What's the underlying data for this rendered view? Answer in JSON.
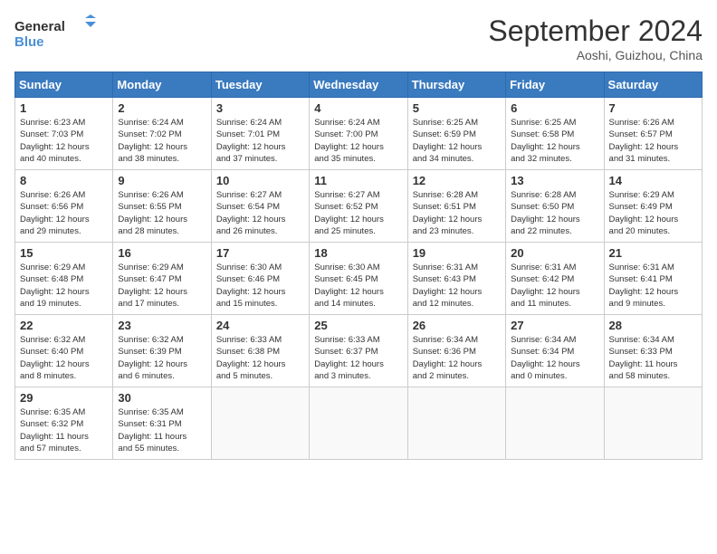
{
  "logo": {
    "line1": "General",
    "line2": "Blue"
  },
  "title": "September 2024",
  "location": "Aoshi, Guizhou, China",
  "days_of_week": [
    "Sunday",
    "Monday",
    "Tuesday",
    "Wednesday",
    "Thursday",
    "Friday",
    "Saturday"
  ],
  "weeks": [
    [
      {
        "day": 1,
        "rise": "6:23 AM",
        "set": "7:03 PM",
        "daylight": "12 hours and 40 minutes."
      },
      {
        "day": 2,
        "rise": "6:24 AM",
        "set": "7:02 PM",
        "daylight": "12 hours and 38 minutes."
      },
      {
        "day": 3,
        "rise": "6:24 AM",
        "set": "7:01 PM",
        "daylight": "12 hours and 37 minutes."
      },
      {
        "day": 4,
        "rise": "6:24 AM",
        "set": "7:00 PM",
        "daylight": "12 hours and 35 minutes."
      },
      {
        "day": 5,
        "rise": "6:25 AM",
        "set": "6:59 PM",
        "daylight": "12 hours and 34 minutes."
      },
      {
        "day": 6,
        "rise": "6:25 AM",
        "set": "6:58 PM",
        "daylight": "12 hours and 32 minutes."
      },
      {
        "day": 7,
        "rise": "6:26 AM",
        "set": "6:57 PM",
        "daylight": "12 hours and 31 minutes."
      }
    ],
    [
      {
        "day": 8,
        "rise": "6:26 AM",
        "set": "6:56 PM",
        "daylight": "12 hours and 29 minutes."
      },
      {
        "day": 9,
        "rise": "6:26 AM",
        "set": "6:55 PM",
        "daylight": "12 hours and 28 minutes."
      },
      {
        "day": 10,
        "rise": "6:27 AM",
        "set": "6:54 PM",
        "daylight": "12 hours and 26 minutes."
      },
      {
        "day": 11,
        "rise": "6:27 AM",
        "set": "6:52 PM",
        "daylight": "12 hours and 25 minutes."
      },
      {
        "day": 12,
        "rise": "6:28 AM",
        "set": "6:51 PM",
        "daylight": "12 hours and 23 minutes."
      },
      {
        "day": 13,
        "rise": "6:28 AM",
        "set": "6:50 PM",
        "daylight": "12 hours and 22 minutes."
      },
      {
        "day": 14,
        "rise": "6:29 AM",
        "set": "6:49 PM",
        "daylight": "12 hours and 20 minutes."
      }
    ],
    [
      {
        "day": 15,
        "rise": "6:29 AM",
        "set": "6:48 PM",
        "daylight": "12 hours and 19 minutes."
      },
      {
        "day": 16,
        "rise": "6:29 AM",
        "set": "6:47 PM",
        "daylight": "12 hours and 17 minutes."
      },
      {
        "day": 17,
        "rise": "6:30 AM",
        "set": "6:46 PM",
        "daylight": "12 hours and 15 minutes."
      },
      {
        "day": 18,
        "rise": "6:30 AM",
        "set": "6:45 PM",
        "daylight": "12 hours and 14 minutes."
      },
      {
        "day": 19,
        "rise": "6:31 AM",
        "set": "6:43 PM",
        "daylight": "12 hours and 12 minutes."
      },
      {
        "day": 20,
        "rise": "6:31 AM",
        "set": "6:42 PM",
        "daylight": "12 hours and 11 minutes."
      },
      {
        "day": 21,
        "rise": "6:31 AM",
        "set": "6:41 PM",
        "daylight": "12 hours and 9 minutes."
      }
    ],
    [
      {
        "day": 22,
        "rise": "6:32 AM",
        "set": "6:40 PM",
        "daylight": "12 hours and 8 minutes."
      },
      {
        "day": 23,
        "rise": "6:32 AM",
        "set": "6:39 PM",
        "daylight": "12 hours and 6 minutes."
      },
      {
        "day": 24,
        "rise": "6:33 AM",
        "set": "6:38 PM",
        "daylight": "12 hours and 5 minutes."
      },
      {
        "day": 25,
        "rise": "6:33 AM",
        "set": "6:37 PM",
        "daylight": "12 hours and 3 minutes."
      },
      {
        "day": 26,
        "rise": "6:34 AM",
        "set": "6:36 PM",
        "daylight": "12 hours and 2 minutes."
      },
      {
        "day": 27,
        "rise": "6:34 AM",
        "set": "6:34 PM",
        "daylight": "12 hours and 0 minutes."
      },
      {
        "day": 28,
        "rise": "6:34 AM",
        "set": "6:33 PM",
        "daylight": "11 hours and 58 minutes."
      }
    ],
    [
      {
        "day": 29,
        "rise": "6:35 AM",
        "set": "6:32 PM",
        "daylight": "11 hours and 57 minutes."
      },
      {
        "day": 30,
        "rise": "6:35 AM",
        "set": "6:31 PM",
        "daylight": "11 hours and 55 minutes."
      },
      null,
      null,
      null,
      null,
      null
    ]
  ],
  "labels": {
    "sunrise": "Sunrise:",
    "sunset": "Sunset:",
    "daylight": "Daylight:"
  }
}
